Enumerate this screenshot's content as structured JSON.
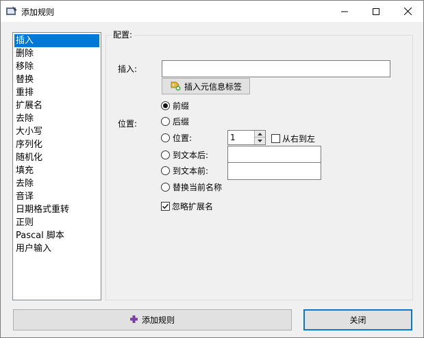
{
  "window": {
    "title": "添加规则",
    "icon": "app-icon",
    "controls": [
      "minimize-icon",
      "maximize-icon",
      "close-icon"
    ]
  },
  "rules": {
    "selected_index": 0,
    "items": [
      {
        "label": "插入"
      },
      {
        "label": "删除"
      },
      {
        "label": "移除"
      },
      {
        "label": "替换"
      },
      {
        "label": "重排"
      },
      {
        "label": "扩展名"
      },
      {
        "label": "去除"
      },
      {
        "label": "大小写"
      },
      {
        "label": "序列化"
      },
      {
        "label": "随机化"
      },
      {
        "label": "填充"
      },
      {
        "label": "去除"
      },
      {
        "label": "音译"
      },
      {
        "label": "日期格式重转"
      },
      {
        "label": "正则"
      },
      {
        "label": "Pascal 脚本"
      },
      {
        "label": "用户输入"
      }
    ]
  },
  "config": {
    "group_label": "配置:",
    "insert_label": "插入:",
    "insert_value": "",
    "insert_meta_button": "插入元信息标签",
    "position_label": "位置:",
    "options": {
      "prefix": "前缀",
      "suffix": "后缀",
      "position": "位置:",
      "after_text": "到文本后:",
      "before_text": "到文本前:",
      "replace_name": "替换当前名称"
    },
    "selected_option": "prefix",
    "position_value": "1",
    "right_to_left_label": "从右到左",
    "right_to_left_checked": false,
    "after_text_value": "",
    "before_text_value": "",
    "ignore_ext_label": "忽略扩展名",
    "ignore_ext_checked": true
  },
  "footer": {
    "add_rule_label": "添加规则",
    "close_label": "关闭"
  },
  "colors": {
    "selection": "#0078d7",
    "add_icon": "#7a3fa0"
  }
}
